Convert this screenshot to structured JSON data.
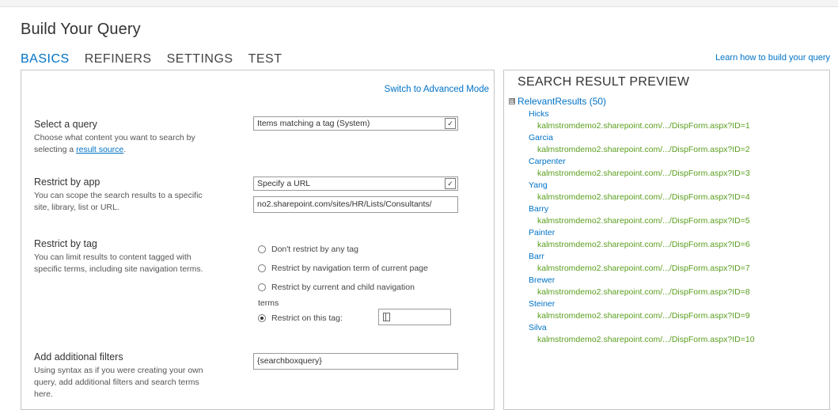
{
  "page": {
    "title": "Build Your Query",
    "learn_link": "Learn how to build your query"
  },
  "tabs": [
    {
      "label": "BASICS",
      "active": true
    },
    {
      "label": "REFINERS",
      "active": false
    },
    {
      "label": "SETTINGS",
      "active": false
    },
    {
      "label": "TEST",
      "active": false
    }
  ],
  "basics": {
    "advanced_link": "Switch to Advanced Mode",
    "select_query": {
      "title": "Select a query",
      "desc_before": "Choose what content you want to search by selecting a ",
      "desc_link": "result source",
      "desc_after": ".",
      "value": "Items matching a tag (System)"
    },
    "restrict_app": {
      "title": "Restrict by app",
      "desc": "You can scope the search results to a specific site, library, list or URL.",
      "value": "Specify a URL",
      "url_value": "no2.sharepoint.com/sites/HR/Lists/Consultants/"
    },
    "restrict_tag": {
      "title": "Restrict by tag",
      "desc": "You can limit results to content tagged with specific terms, including site navigation terms.",
      "options": [
        {
          "label": "Don't restrict by any tag",
          "selected": false
        },
        {
          "label": "Restrict by navigation term of current page",
          "selected": false
        },
        {
          "label": "Restrict by current and child navigation",
          "label2": "terms",
          "selected": false
        },
        {
          "label": "Restrict on this tag:",
          "selected": true
        }
      ]
    },
    "filters": {
      "title": "Add additional filters",
      "desc": "Using syntax as if you were creating your own query, add additional filters and search terms here.",
      "value": "{searchboxquery}"
    }
  },
  "preview": {
    "title": "SEARCH RESULT PREVIEW",
    "group_toggle": "⊟",
    "group_label": "RelevantResults (50)",
    "results": [
      {
        "name": "Hicks",
        "url": "kalmstromdemo2.sharepoint.com/.../DispForm.aspx?ID=1"
      },
      {
        "name": "Garcia",
        "url": "kalmstromdemo2.sharepoint.com/.../DispForm.aspx?ID=2"
      },
      {
        "name": "Carpenter",
        "url": "kalmstromdemo2.sharepoint.com/.../DispForm.aspx?ID=3"
      },
      {
        "name": "Yang",
        "url": "kalmstromdemo2.sharepoint.com/.../DispForm.aspx?ID=4"
      },
      {
        "name": "Barry",
        "url": "kalmstromdemo2.sharepoint.com/.../DispForm.aspx?ID=5"
      },
      {
        "name": "Painter",
        "url": "kalmstromdemo2.sharepoint.com/.../DispForm.aspx?ID=6"
      },
      {
        "name": "Barr",
        "url": "kalmstromdemo2.sharepoint.com/.../DispForm.aspx?ID=7"
      },
      {
        "name": "Brewer",
        "url": "kalmstromdemo2.sharepoint.com/.../DispForm.aspx?ID=8"
      },
      {
        "name": "Steiner",
        "url": "kalmstromdemo2.sharepoint.com/.../DispForm.aspx?ID=9"
      },
      {
        "name": "Silva",
        "url": "kalmstromdemo2.sharepoint.com/.../DispForm.aspx?ID=10"
      }
    ]
  },
  "colors": {
    "accent": "#0072c6",
    "result_url": "#5a9e1e"
  }
}
